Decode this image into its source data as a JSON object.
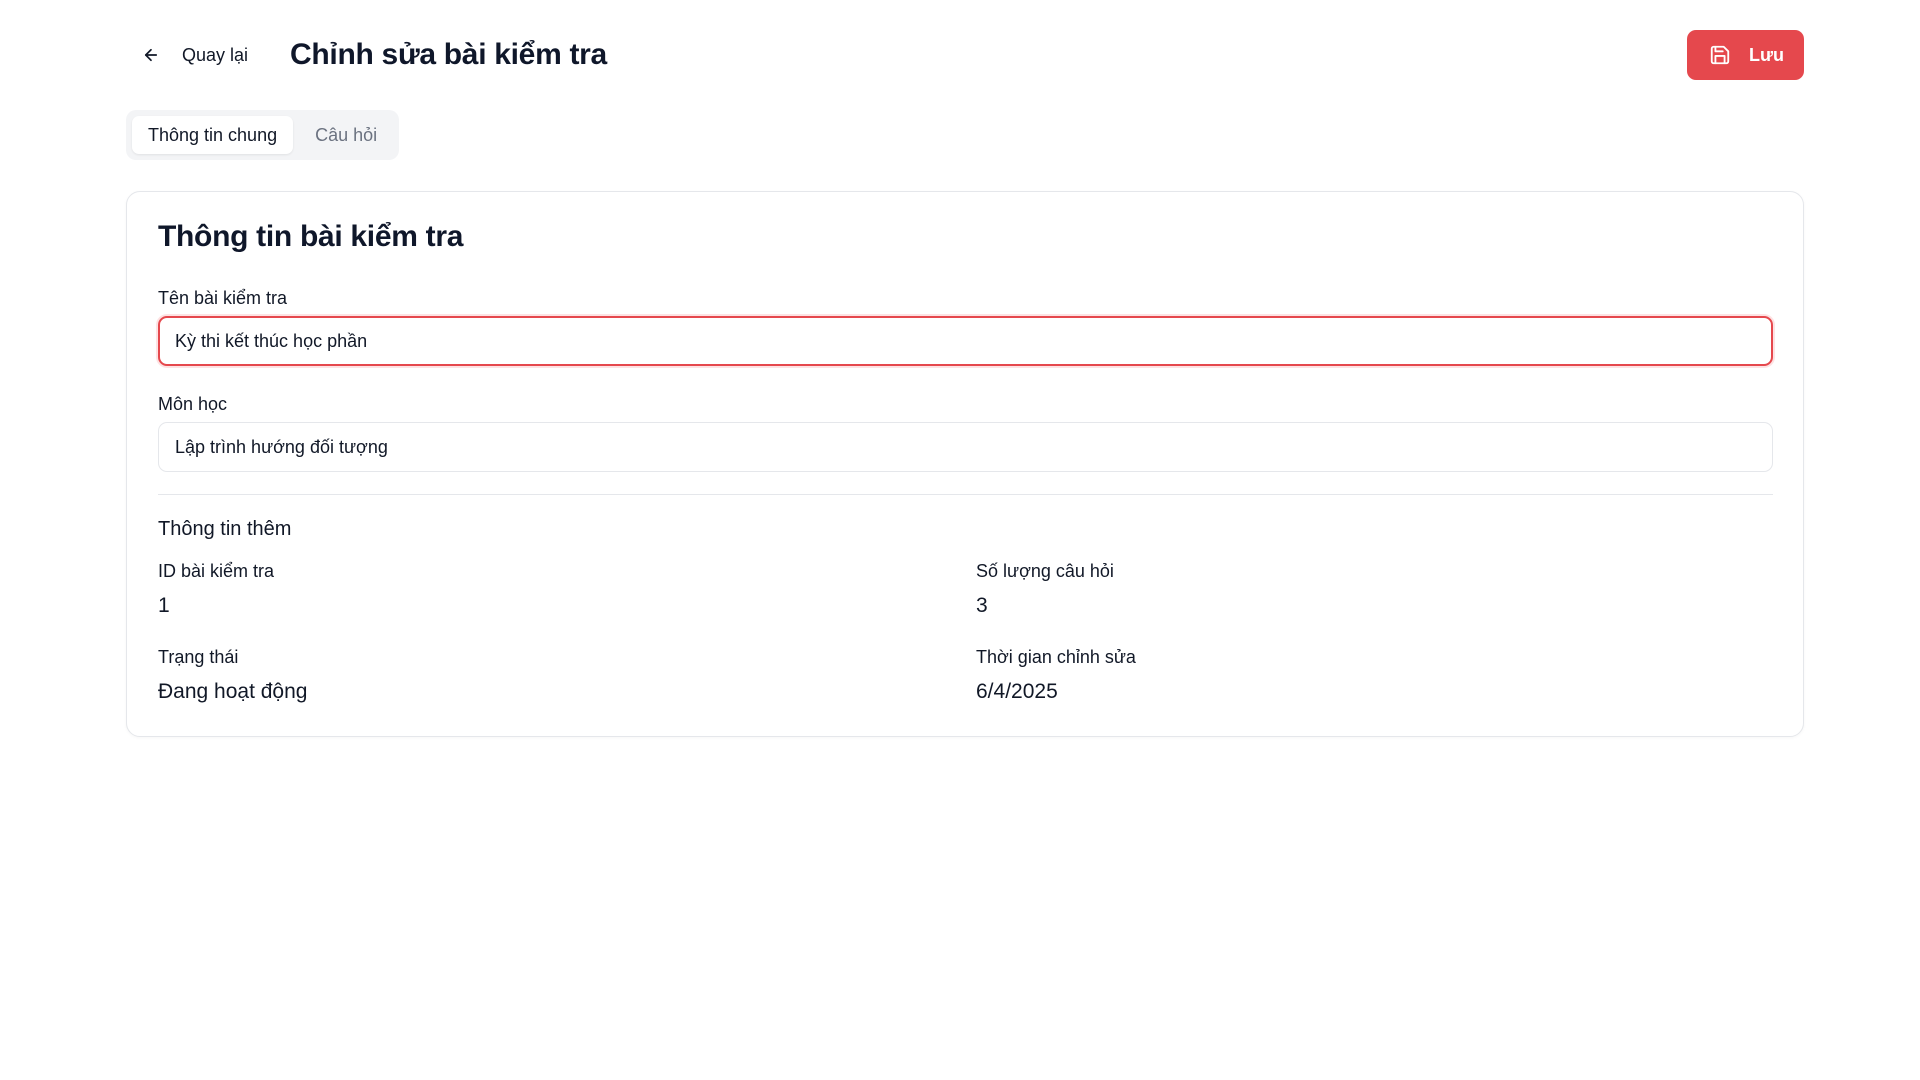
{
  "header": {
    "back_label": "Quay lại",
    "title": "Chỉnh sửa bài kiểm tra",
    "save_label": "Lưu",
    "back_icon": "arrow-left-icon",
    "save_icon": "floppy-disk-icon"
  },
  "tabs": [
    {
      "label": "Thông tin chung",
      "active": true
    },
    {
      "label": "Câu hỏi",
      "active": false
    }
  ],
  "card": {
    "title": "Thông tin bài kiểm tra",
    "exam_name": {
      "label": "Tên bài kiểm tra",
      "value": "Kỳ thi kết thúc học phần"
    },
    "subject": {
      "label": "Môn học",
      "value": "Lập trình hướng đối tượng"
    },
    "extra": {
      "title": "Thông tin thêm",
      "id": {
        "label": "ID bài kiểm tra",
        "value": "1"
      },
      "question_count": {
        "label": "Số lượng câu hỏi",
        "value": "3"
      },
      "status": {
        "label": "Trạng thái",
        "value": "Đang hoạt động"
      },
      "edited_time": {
        "label": "Thời gian chỉnh sửa",
        "value": "6/4/2025"
      }
    }
  },
  "colors": {
    "accent": "#e5484d",
    "border": "#e5e7eb",
    "tab_bg": "#f3f4f6"
  }
}
